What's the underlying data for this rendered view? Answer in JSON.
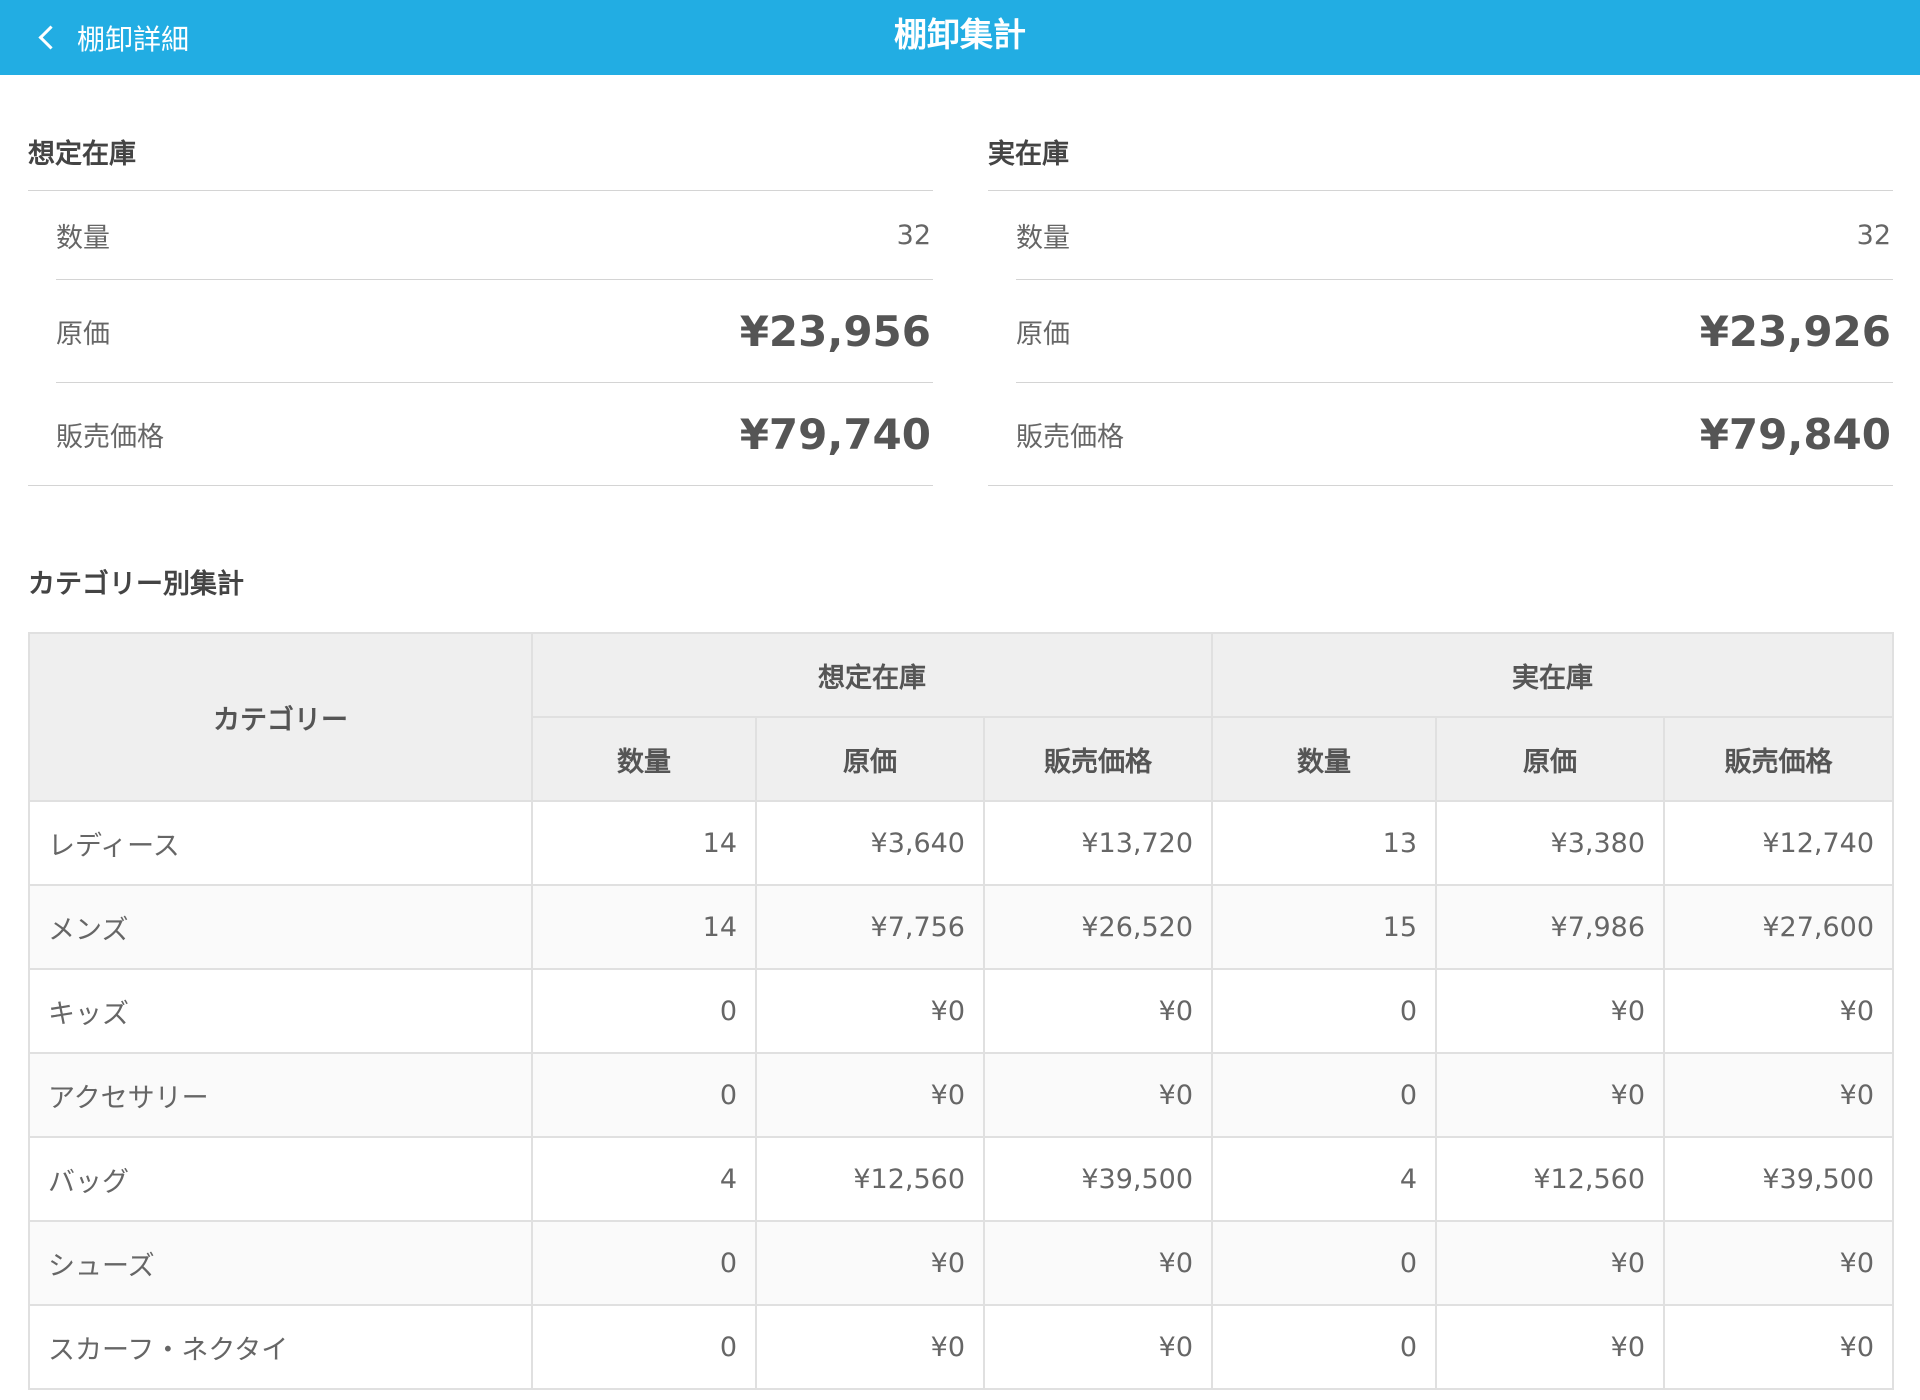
{
  "navbar": {
    "back_label": "棚卸詳細",
    "title": "棚卸集計",
    "color": "#22ade3"
  },
  "expected": {
    "title": "想定在庫",
    "qty_label": "数量",
    "qty": "32",
    "cost_label": "原価",
    "cost": "¥23,956",
    "price_label": "販売価格",
    "price": "¥79,740"
  },
  "actual": {
    "title": "実在庫",
    "qty_label": "数量",
    "qty": "32",
    "cost_label": "原価",
    "cost": "¥23,926",
    "price_label": "販売価格",
    "price": "¥79,840"
  },
  "category_section": {
    "title": "カテゴリー別集計",
    "headers": {
      "category": "カテゴリー",
      "expected": "想定在庫",
      "actual": "実在庫",
      "qty": "数量",
      "cost": "原価",
      "price": "販売価格"
    },
    "rows": [
      {
        "name": "レディース",
        "e_qty": "14",
        "e_cost": "¥3,640",
        "e_price": "¥13,720",
        "a_qty": "13",
        "a_cost": "¥3,380",
        "a_price": "¥12,740"
      },
      {
        "name": "メンズ",
        "e_qty": "14",
        "e_cost": "¥7,756",
        "e_price": "¥26,520",
        "a_qty": "15",
        "a_cost": "¥7,986",
        "a_price": "¥27,600"
      },
      {
        "name": "キッズ",
        "e_qty": "0",
        "e_cost": "¥0",
        "e_price": "¥0",
        "a_qty": "0",
        "a_cost": "¥0",
        "a_price": "¥0"
      },
      {
        "name": "アクセサリー",
        "e_qty": "0",
        "e_cost": "¥0",
        "e_price": "¥0",
        "a_qty": "0",
        "a_cost": "¥0",
        "a_price": "¥0"
      },
      {
        "name": "バッグ",
        "e_qty": "4",
        "e_cost": "¥12,560",
        "e_price": "¥39,500",
        "a_qty": "4",
        "a_cost": "¥12,560",
        "a_price": "¥39,500"
      },
      {
        "name": "シューズ",
        "e_qty": "0",
        "e_cost": "¥0",
        "e_price": "¥0",
        "a_qty": "0",
        "a_cost": "¥0",
        "a_price": "¥0"
      },
      {
        "name": "スカーフ・ネクタイ",
        "e_qty": "0",
        "e_cost": "¥0",
        "e_price": "¥0",
        "a_qty": "0",
        "a_cost": "¥0",
        "a_price": "¥0"
      }
    ]
  }
}
